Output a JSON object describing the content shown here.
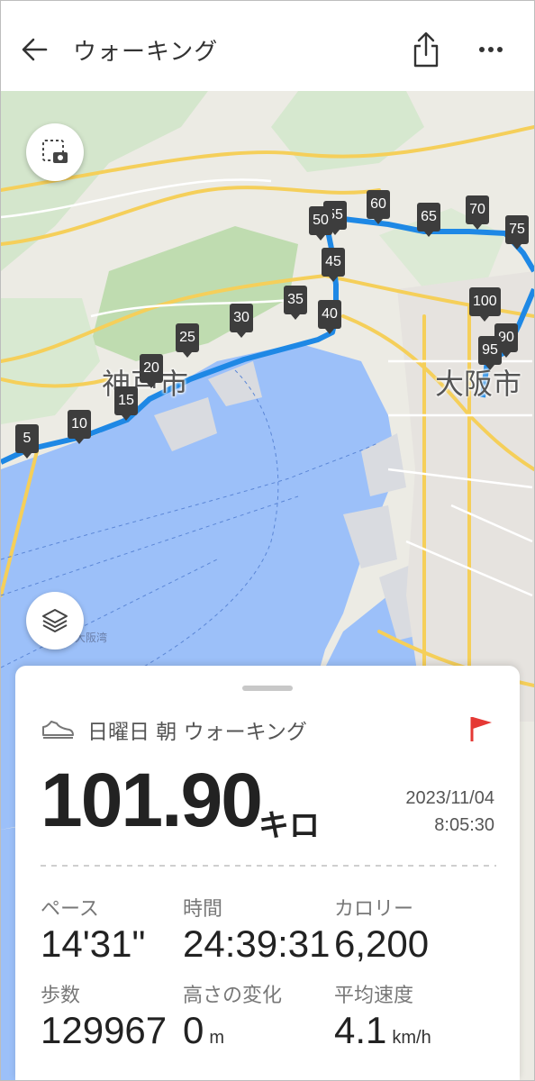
{
  "appbar": {
    "title": "ウォーキング",
    "icons": [
      "back-arrow-icon",
      "share-icon",
      "more-icon"
    ]
  },
  "map": {
    "city_labels": [
      "神戸市",
      "大阪市"
    ],
    "bay_label": "大阪湾",
    "markers": [
      "5",
      "10",
      "15",
      "20",
      "25",
      "30",
      "35",
      "40",
      "45",
      "50",
      "55",
      "60",
      "65",
      "70",
      "75",
      "90",
      "95",
      "100"
    ],
    "route_color": "#1e88e5"
  },
  "activity": {
    "name": "日曜日 朝 ウォーキング",
    "distance": "101.90",
    "distance_unit": "キロ",
    "date": "2023/11/04",
    "time": "8:05:30",
    "flag_color": "#e53935"
  },
  "stats": {
    "pace_label": "ペース",
    "pace_value": "14'31\"",
    "duration_label": "時間",
    "duration_value": "24:39:31",
    "calories_label": "カロリー",
    "calories_value": "6,200",
    "steps_label": "歩数",
    "steps_value": "129967",
    "elevation_label": "高さの変化",
    "elevation_value": "0",
    "elevation_unit": "m",
    "speed_label": "平均速度",
    "speed_value": "4.1",
    "speed_unit": "km/h"
  }
}
